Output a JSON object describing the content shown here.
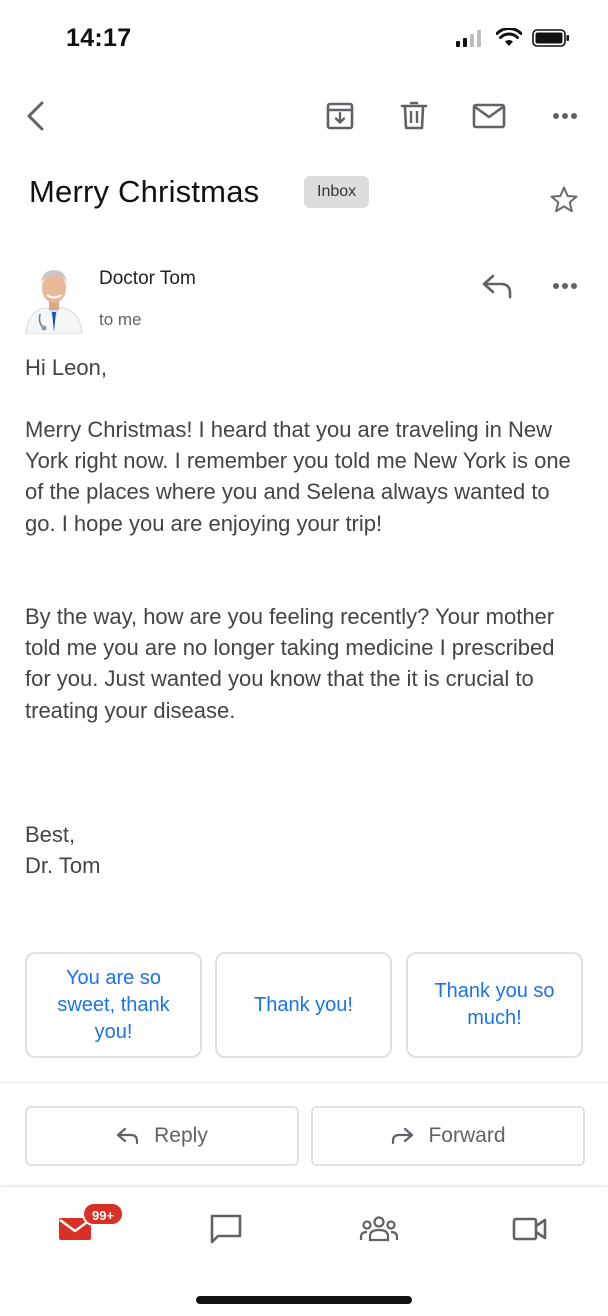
{
  "status_bar": {
    "time": "14:17",
    "icons": [
      "signal-icon",
      "wifi-icon",
      "battery-icon"
    ]
  },
  "toolbar": {
    "icons": [
      "back-arrow-icon",
      "archive-icon",
      "trash-icon",
      "mark-unread-icon",
      "more-icon"
    ]
  },
  "email": {
    "subject": "Merry Christmas",
    "label": "Inbox",
    "sender": "Doctor Tom",
    "recipient": "to me",
    "greeting": "Hi Leon,",
    "paragraph1": "Merry Christmas! I heard that you are traveling in New York right now. I remember you told me New York is one of the places where you and Selena always wanted to go. I hope you are enjoying your trip!",
    "paragraph2": "By the way, how are you feeling recently? Your mother told me you are no longer taking medicine I prescribed for you. Just wanted you know that the it is crucial to treating your disease.",
    "signoff": "Best,",
    "signature": "Dr. Tom"
  },
  "smart_replies": [
    "You are so sweet, thank you!",
    "Thank you!",
    "Thank you so much!"
  ],
  "actions": {
    "reply_label": "Reply",
    "forward_label": "Forward"
  },
  "bottom_nav": {
    "mail_badge": "99+",
    "items": [
      "mail-icon",
      "chat-icon",
      "spaces-icon",
      "meet-icon"
    ]
  },
  "colors": {
    "accent": "#1a73e8",
    "badge": "#d93025",
    "mail_icon": "#d93025"
  }
}
